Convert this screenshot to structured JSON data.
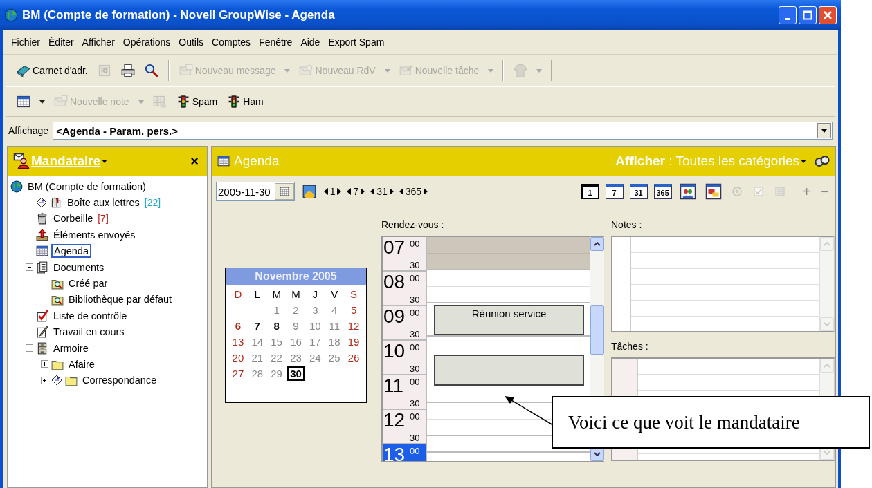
{
  "window": {
    "title": "BM (Compte de formation) - Novell GroupWise - Agenda"
  },
  "menu": [
    "Fichier",
    "Éditer",
    "Afficher",
    "Opérations",
    "Outils",
    "Comptes",
    "Fenêtre",
    "Aide",
    "Export Spam"
  ],
  "toolbar_1": [
    {
      "kind": "address-book",
      "label": "Carnet d'adr.",
      "disabled": false
    },
    {
      "kind": "preview",
      "disabled": true
    },
    {
      "kind": "print",
      "disabled": false
    },
    {
      "kind": "find",
      "disabled": false
    },
    {
      "kind": "separator"
    },
    {
      "kind": "new-message",
      "label": "Nouveau message",
      "disabled": true
    },
    {
      "kind": "caret",
      "disabled": true
    },
    {
      "kind": "new-appointment",
      "label": "Nouveau RdV",
      "disabled": true
    },
    {
      "kind": "caret",
      "disabled": true
    },
    {
      "kind": "new-task",
      "label": "Nouvelle tâche",
      "disabled": true
    },
    {
      "kind": "caret",
      "disabled": true
    },
    {
      "kind": "separator"
    },
    {
      "kind": "figure",
      "disabled": true
    },
    {
      "kind": "caret",
      "disabled": true
    },
    {
      "kind": "separator"
    }
  ],
  "toolbar_2": [
    {
      "kind": "calendar",
      "disabled": false
    },
    {
      "kind": "caret",
      "disabled": false
    },
    {
      "kind": "new-note",
      "label": "Nouvelle note",
      "disabled": true
    },
    {
      "kind": "caret",
      "disabled": true
    },
    {
      "kind": "grid",
      "disabled": true
    },
    {
      "kind": "spam",
      "label": "Spam",
      "disabled": false
    },
    {
      "kind": "ham",
      "label": "Ham",
      "disabled": false
    }
  ],
  "view_bar": {
    "label": "Affichage",
    "value": "<Agenda - Param. pers.>"
  },
  "left_panel": {
    "title": "Mandataire",
    "close": "×",
    "tree": [
      {
        "label": "BM (Compte de formation)",
        "kind": "globe",
        "selected": false,
        "shared": false,
        "children": [
          {
            "label": "Boîte aux lettres",
            "count": "[22]",
            "color": "#22a8c8",
            "kind": "mailbox",
            "selected": false,
            "shared": true
          },
          {
            "label": "Corbeille",
            "count": "[7]",
            "color": "#c02020",
            "kind": "trash",
            "selected": false,
            "shared": false
          },
          {
            "label": "Éléments envoyés",
            "kind": "sent",
            "selected": false,
            "shared": false
          },
          {
            "label": "Agenda",
            "kind": "calendar",
            "selected": true,
            "shared": false
          },
          {
            "label": "Documents",
            "kind": "documents",
            "selected": false,
            "shared": false,
            "expanded": true,
            "children": [
              {
                "label": "Créé par",
                "kind": "query",
                "selected": false,
                "shared": false
              },
              {
                "label": "Bibliothèque par défaut",
                "kind": "query",
                "selected": false,
                "shared": false
              }
            ]
          },
          {
            "label": "Liste de contrôle",
            "kind": "checklist",
            "selected": false,
            "shared": false
          },
          {
            "label": "Travail en cours",
            "kind": "work",
            "selected": false,
            "shared": false
          },
          {
            "label": "Armoire",
            "kind": "cabinet",
            "selected": false,
            "shared": false,
            "expanded": true,
            "children": [
              {
                "label": "Afaire",
                "kind": "folder",
                "selected": false,
                "shared": false,
                "expanded": false
              },
              {
                "label": "Correspondance",
                "kind": "folder",
                "selected": false,
                "shared": true,
                "expanded": false
              }
            ]
          }
        ]
      }
    ]
  },
  "right_panel": {
    "title": "Agenda",
    "filter": "**Afficher** : Toutes les catégories",
    "date": "2005-11-30",
    "nav": [
      "1",
      "7",
      "31",
      "365"
    ],
    "tools": [
      {
        "kind": "view",
        "label": "1",
        "selected": true
      },
      {
        "kind": "view",
        "label": "7",
        "selected": false
      },
      {
        "kind": "view",
        "label": "31",
        "selected": false
      },
      {
        "kind": "view",
        "label": "365",
        "selected": false
      },
      {
        "kind": "people",
        "selected": false
      },
      {
        "kind": "projects",
        "selected": false
      },
      {
        "kind": "target",
        "disabled": true
      },
      {
        "kind": "check",
        "disabled": true
      },
      {
        "kind": "note",
        "disabled": true
      },
      {
        "kind": "separator"
      },
      {
        "kind": "zoom",
        "label": "+",
        "disabled": true
      },
      {
        "kind": "zoom",
        "label": "−",
        "disabled": true
      }
    ],
    "month": {
      "title": "Novembre 2005",
      "weekdays": [
        {
          "label": "D",
          "weekend": true
        },
        {
          "label": "L",
          "weekend": false
        },
        {
          "label": "M",
          "weekend": false
        },
        {
          "label": "M",
          "weekend": false
        },
        {
          "label": "J",
          "weekend": false
        },
        {
          "label": "V",
          "weekend": false
        },
        {
          "label": "S",
          "weekend": true
        }
      ],
      "weeks": [
        [
          {
            "kind": "blank"
          },
          {
            "kind": "blank"
          },
          {
            "kind": "day",
            "day": "1",
            "bold": false,
            "selected": false
          },
          {
            "kind": "day",
            "day": "2",
            "bold": false,
            "selected": false
          },
          {
            "kind": "day",
            "day": "3",
            "bold": false,
            "selected": false
          },
          {
            "kind": "day",
            "day": "4",
            "bold": false,
            "selected": false
          },
          {
            "kind": "day",
            "day": "5",
            "bold": false,
            "selected": false
          }
        ],
        [
          {
            "kind": "day",
            "day": "6",
            "bold": true,
            "selected": false
          },
          {
            "kind": "day",
            "day": "7",
            "bold": true,
            "selected": false
          },
          {
            "kind": "day",
            "day": "8",
            "bold": true,
            "selected": false
          },
          {
            "kind": "day",
            "day": "9",
            "bold": false,
            "selected": false
          },
          {
            "kind": "day",
            "day": "10",
            "bold": false,
            "selected": false
          },
          {
            "kind": "day",
            "day": "11",
            "bold": false,
            "selected": false
          },
          {
            "kind": "day",
            "day": "12",
            "bold": false,
            "selected": false
          }
        ],
        [
          {
            "kind": "day",
            "day": "13",
            "bold": false,
            "selected": false
          },
          {
            "kind": "day",
            "day": "14",
            "bold": false,
            "selected": false
          },
          {
            "kind": "day",
            "day": "15",
            "bold": false,
            "selected": false
          },
          {
            "kind": "day",
            "day": "16",
            "bold": false,
            "selected": false
          },
          {
            "kind": "day",
            "day": "17",
            "bold": false,
            "selected": false
          },
          {
            "kind": "day",
            "day": "18",
            "bold": false,
            "selected": false
          },
          {
            "kind": "day",
            "day": "19",
            "bold": false,
            "selected": false
          }
        ],
        [
          {
            "kind": "day",
            "day": "20",
            "bold": false,
            "selected": false
          },
          {
            "kind": "day",
            "day": "21",
            "bold": false,
            "selected": false
          },
          {
            "kind": "day",
            "day": "22",
            "bold": false,
            "selected": false
          },
          {
            "kind": "day",
            "day": "23",
            "bold": false,
            "selected": false
          },
          {
            "kind": "day",
            "day": "24",
            "bold": false,
            "selected": false
          },
          {
            "kind": "day",
            "day": "25",
            "bold": false,
            "selected": false
          },
          {
            "kind": "day",
            "day": "26",
            "bold": false,
            "selected": false
          }
        ],
        [
          {
            "kind": "day",
            "day": "27",
            "bold": false,
            "selected": false
          },
          {
            "kind": "day",
            "day": "28",
            "bold": false,
            "selected": false
          },
          {
            "kind": "day",
            "day": "29",
            "bold": false,
            "selected": false
          },
          {
            "kind": "day",
            "day": "30",
            "bold": false,
            "selected": true
          }
        ]
      ]
    },
    "appointments_label": "Rendez-vous :",
    "hours": [
      {
        "hour": "07",
        "minutes": [
          "00",
          "30"
        ],
        "current": false,
        "slots": [
          {
            "off_hours": true,
            "booked": false
          },
          {
            "off_hours": true,
            "booked": false
          }
        ]
      },
      {
        "hour": "08",
        "minutes": [
          "00",
          "30"
        ],
        "current": false,
        "slots": [
          {
            "off_hours": false,
            "booked": false
          },
          {
            "off_hours": false,
            "booked": false
          }
        ]
      },
      {
        "hour": "09",
        "minutes": [
          "00",
          "30"
        ],
        "current": false,
        "slots": [
          {
            "booked": true,
            "title": "Réunion service"
          },
          {
            "booked": true
          }
        ]
      },
      {
        "hour": "10",
        "minutes": [
          "00",
          "30"
        ],
        "current": false,
        "slots": [
          {
            "off_hours": false,
            "booked": false
          },
          {
            "booked": true
          }
        ]
      },
      {
        "hour": "11",
        "minutes": [
          "00",
          "30"
        ],
        "current": false,
        "slots": [
          {
            "booked": true
          },
          {
            "off_hours": false,
            "booked": false
          }
        ]
      },
      {
        "hour": "12",
        "minutes": [
          "00",
          "30"
        ],
        "current": false,
        "slots": [
          {
            "off_hours": false,
            "booked": false
          },
          {
            "off_hours": false,
            "booked": false
          }
        ]
      },
      {
        "hour": "13",
        "minutes": [
          "00"
        ],
        "current": true,
        "slots": [
          {
            "off_hours": false,
            "booked": false
          }
        ]
      }
    ],
    "notes_label": "Notes :",
    "tasks_label": "Tâches :"
  },
  "callout": {
    "text": "Voici ce que voit le mandataire"
  }
}
